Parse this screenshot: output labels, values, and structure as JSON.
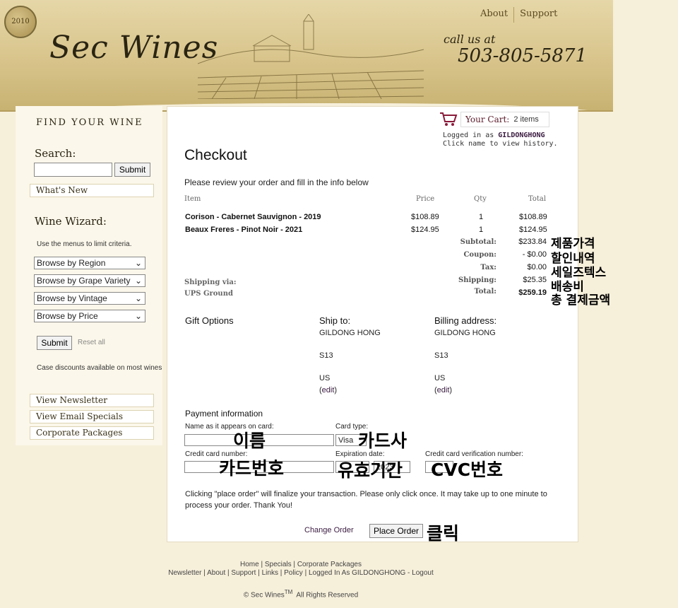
{
  "header": {
    "seal_text": "2010",
    "logo": "Sec Wines",
    "callus": "call us at",
    "phone": "503-805-5871",
    "nav": [
      "About",
      "Support"
    ]
  },
  "sidebar": {
    "find_heading": "FIND YOUR WINE",
    "search_heading": "Search:",
    "search_button": "Submit",
    "whats_new": "What's New",
    "wizard_heading": "Wine Wizard:",
    "wizard_note": "Use the menus to limit criteria.",
    "selects": [
      "Browse by Region",
      "Browse by Grape Variety",
      "Browse by Vintage",
      "Browse by Price"
    ],
    "submit": "Submit",
    "reset": "Reset all",
    "discount": "Case discounts available on most wines",
    "links": [
      "View Newsletter",
      "View Email Specials",
      "Corporate Packages"
    ]
  },
  "cart": {
    "label": "Your Cart:",
    "count": "2 items",
    "logged_prefix": "Logged in as",
    "user": "GILDONGHONG",
    "history": "Click name to view history."
  },
  "checkout": {
    "title": "Checkout",
    "review": "Please review your order and fill in the info below",
    "columns": {
      "item": "Item",
      "price": "Price",
      "qty": "Qty",
      "total": "Total"
    },
    "items": [
      {
        "name": "Corison - Cabernet Sauvignon - 2019",
        "price": "$108.89",
        "qty": "1",
        "total": "$108.89"
      },
      {
        "name": "Beaux Freres - Pinot Noir - 2021",
        "price": "$124.95",
        "qty": "1",
        "total": "$124.95"
      }
    ],
    "summary": [
      {
        "label": "Subtotal:",
        "value": "$233.84"
      },
      {
        "label": "Coupon:",
        "value": "- $0.00"
      },
      {
        "label": "Tax:",
        "value": "$0.00"
      },
      {
        "label": "Shipping:",
        "value": "$25.35"
      },
      {
        "label": "Total:",
        "value": "$259.19"
      }
    ],
    "shipping_via_label": "Shipping via:",
    "shipping_via": "UPS Ground",
    "gift_options": "Gift Options",
    "ship_to": {
      "heading": "Ship to:",
      "name": "GILDONG HONG",
      "line2": "S13",
      "country": "US",
      "edit": "edit"
    },
    "billing": {
      "heading": "Billing address:",
      "name": "GILDONG HONG",
      "line2": "S13",
      "country": "US",
      "edit": "edit"
    },
    "payment_heading": "Payment information",
    "name_label": "Name as it appears on card:",
    "card_type_label": "Card type:",
    "card_type": "Visa",
    "cc_label": "Credit card number:",
    "exp_label": "Expiration date:",
    "exp_year": "2023",
    "cvv_label": "Credit card verification number:",
    "notice": "Clicking \"place order\" will finalize your transaction. Please only click once. It may take up to one minute to process your order. Thank You!",
    "change_order": "Change Order",
    "place_order": "Place Order"
  },
  "annotations": {
    "subtotal": "제품가격",
    "coupon": "할인내역",
    "tax": "세일즈텍스",
    "shipping": "배송비",
    "total": "총 결제금액",
    "name": "이름",
    "card_type": "카드사",
    "cc_number": "카드번호",
    "expiry": "유효기간",
    "cvc": "CVC번호",
    "click": "클릭"
  },
  "footer": {
    "row1": [
      "Home",
      "Specials",
      "Corporate Packages"
    ],
    "row2": [
      "Newsletter",
      "About",
      "Support",
      "Links",
      "Policy",
      "Logged In As GILDONGHONG - Logout"
    ],
    "copyright_pre": "© Sec Wines",
    "tm": "TM",
    "copyright_post": "All Rights Reserved"
  }
}
